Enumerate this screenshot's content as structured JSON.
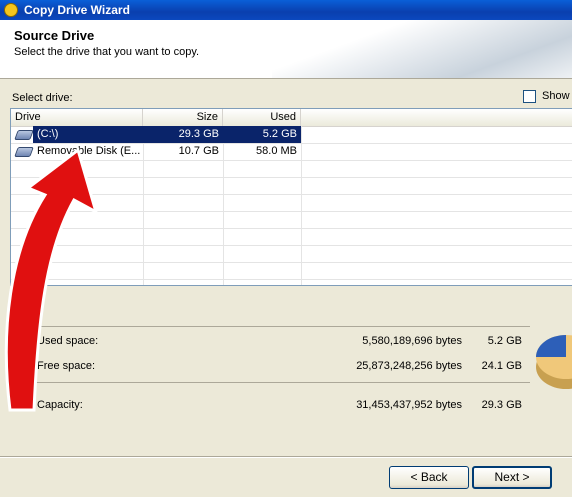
{
  "window": {
    "title": "Copy Drive Wizard"
  },
  "header": {
    "title": "Source Drive",
    "subtitle": "Select the drive that you want to copy."
  },
  "select_label": "Select drive:",
  "show_option": {
    "label": "Show",
    "checked": false
  },
  "table": {
    "columns": [
      "Drive",
      "Size",
      "Used"
    ],
    "rows": [
      {
        "drive": "(C:\\)",
        "size": "29.3 GB",
        "used": "5.2 GB",
        "selected": true
      },
      {
        "drive": "Removable Disk (E...",
        "size": "10.7 GB",
        "used": "58.0 MB",
        "selected": false
      }
    ]
  },
  "stats": {
    "used": {
      "label": "Used space:",
      "bytes": "5,580,189,696 bytes",
      "gb": "5.2 GB"
    },
    "free": {
      "label": "Free space:",
      "bytes": "25,873,248,256 bytes",
      "gb": "24.1 GB"
    },
    "capacity": {
      "label": "Capacity:",
      "bytes": "31,453,437,952 bytes",
      "gb": "29.3 GB"
    }
  },
  "buttons": {
    "back": "< Back",
    "next": "Next >"
  },
  "colors": {
    "pie_used": "#2d5fb8",
    "pie_free": "#f0c87a",
    "arrow": "#e01010"
  }
}
